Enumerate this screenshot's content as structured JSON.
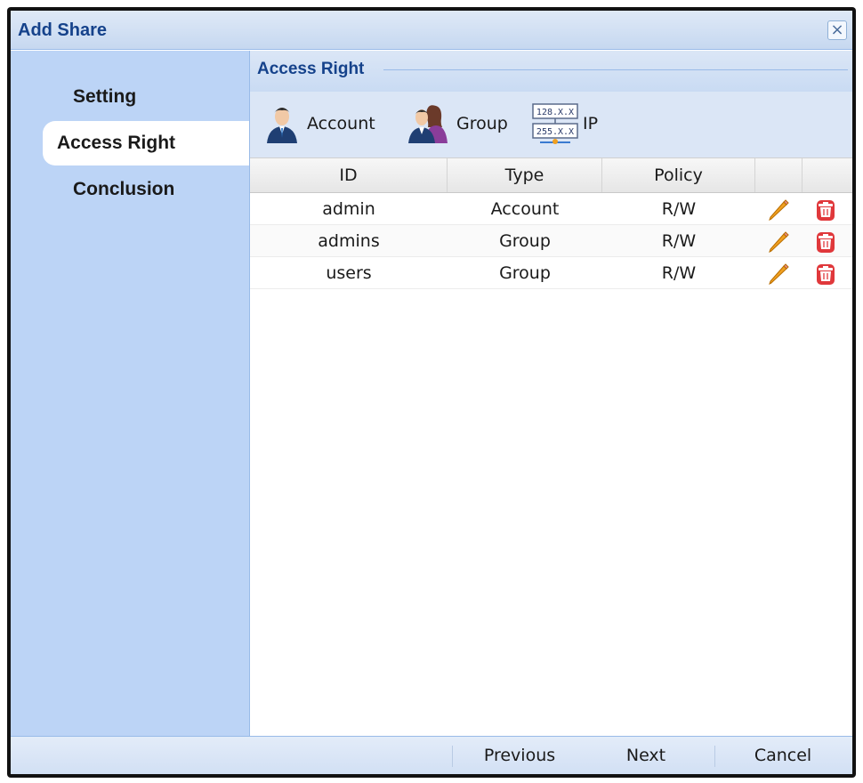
{
  "dialog": {
    "title": "Add Share"
  },
  "sidebar": {
    "items": [
      {
        "label": "Setting",
        "active": false
      },
      {
        "label": "Access Right",
        "active": true
      },
      {
        "label": "Conclusion",
        "active": false
      }
    ]
  },
  "section": {
    "title": "Access Right"
  },
  "toolbar": {
    "account_label": "Account",
    "group_label": "Group",
    "ip_label": "IP",
    "ip_icon_lines": [
      "128.X.X",
      "255.X.X"
    ]
  },
  "table": {
    "headers": {
      "id": "ID",
      "type": "Type",
      "policy": "Policy"
    },
    "rows": [
      {
        "id": "admin",
        "type": "Account",
        "policy": "R/W"
      },
      {
        "id": "admins",
        "type": "Group",
        "policy": "R/W"
      },
      {
        "id": "users",
        "type": "Group",
        "policy": "R/W"
      }
    ]
  },
  "footer": {
    "previous_label": "Previous",
    "next_label": "Next",
    "cancel_label": "Cancel"
  },
  "colors": {
    "title_text": "#15428b",
    "sidebar_bg": "#bcd4f6",
    "header_bg": "#dbe6f6",
    "edit_icon": "#f0a020",
    "delete_icon": "#e0383b"
  },
  "icons": {
    "close": "close-icon",
    "account": "user-icon",
    "group": "group-icon",
    "ip": "ip-address-icon",
    "edit": "pencil-icon",
    "delete": "trash-icon"
  }
}
